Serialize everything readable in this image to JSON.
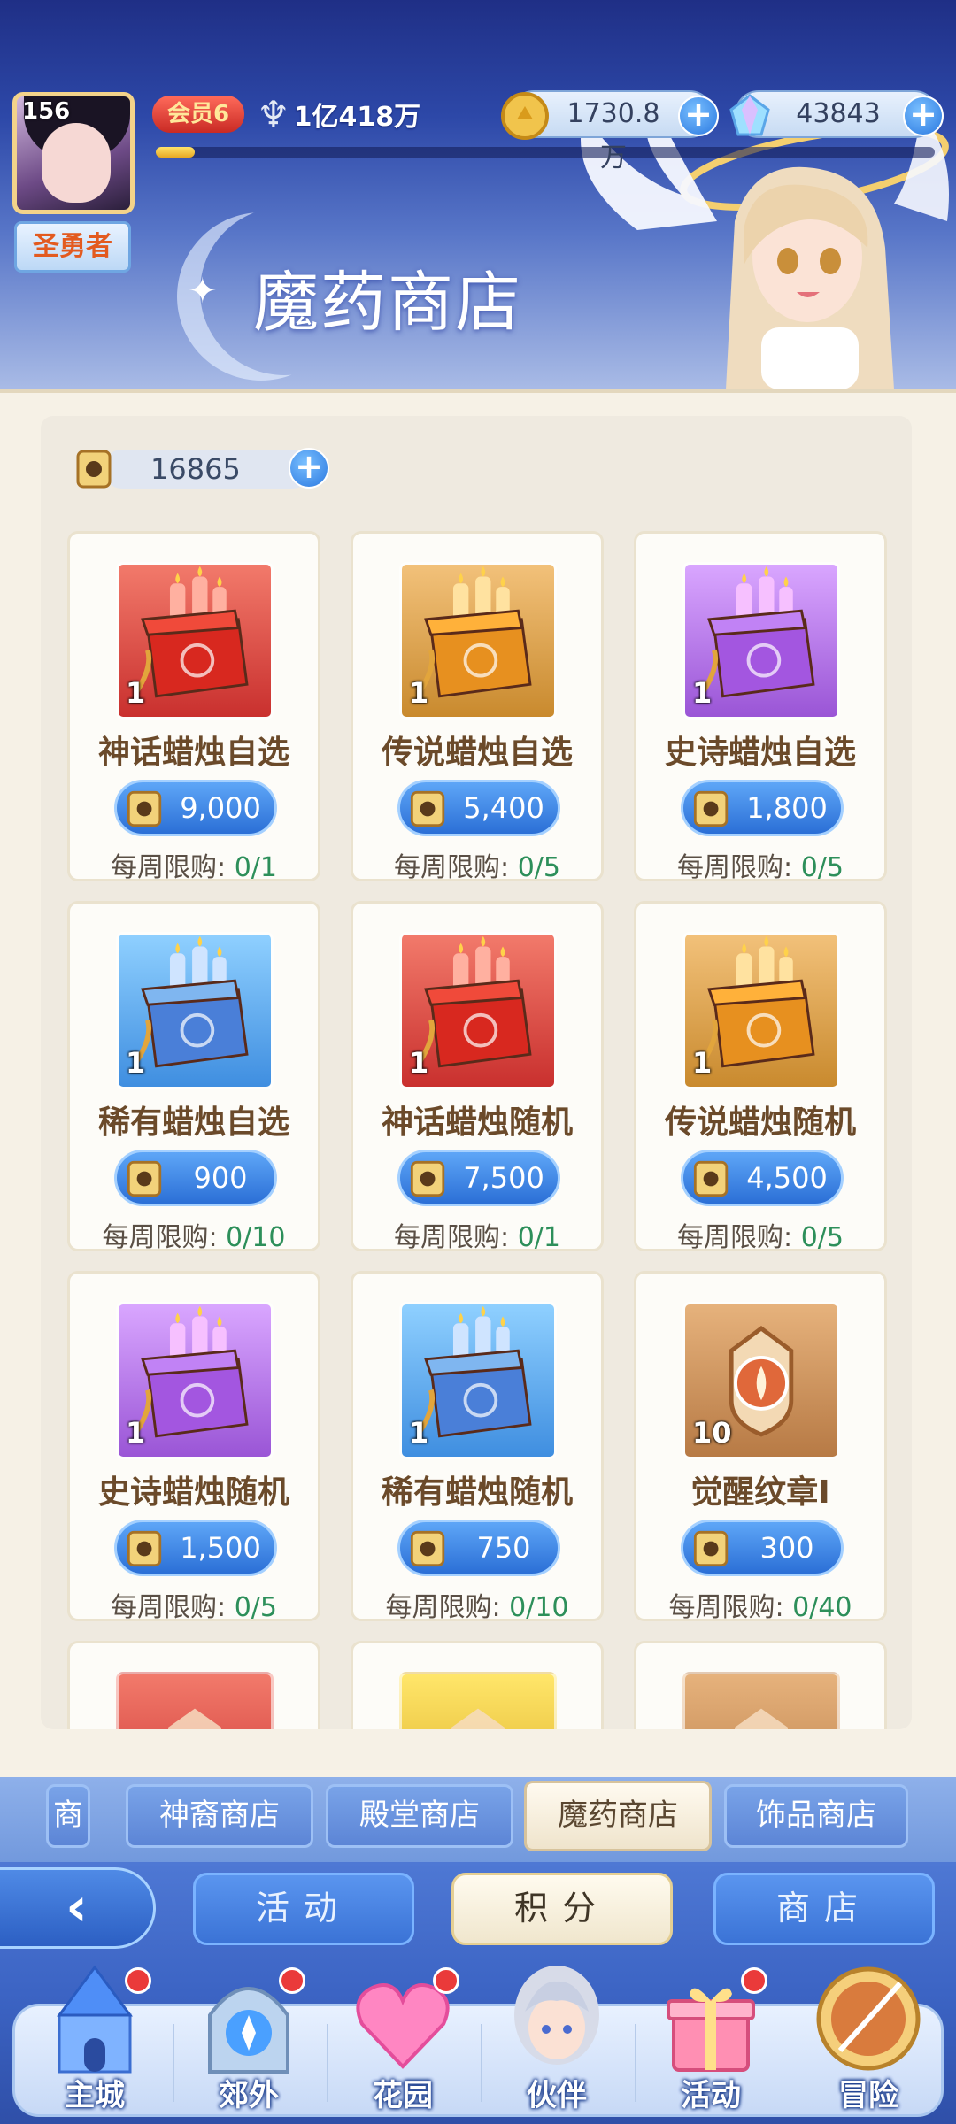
{
  "player": {
    "level": "156",
    "title": "圣勇者",
    "vip": "会员6",
    "power": "1亿418万",
    "exp_fraction": 0.05
  },
  "currencies": {
    "gold": "1730.8万",
    "diamond": "43843",
    "scroll": "16865"
  },
  "shop_title": "魔药商店",
  "items": [
    {
      "name": "神话蜡烛自选",
      "qty": "1",
      "price": "9,000",
      "limit_label": "每周限购:",
      "limit": "0/1",
      "theme": "red"
    },
    {
      "name": "传说蜡烛自选",
      "qty": "1",
      "price": "5,400",
      "limit_label": "每周限购:",
      "limit": "0/5",
      "theme": "orange"
    },
    {
      "name": "史诗蜡烛自选",
      "qty": "1",
      "price": "1,800",
      "limit_label": "每周限购:",
      "limit": "0/5",
      "theme": "purple"
    },
    {
      "name": "稀有蜡烛自选",
      "qty": "1",
      "price": "900",
      "limit_label": "每周限购:",
      "limit": "0/10",
      "theme": "blue"
    },
    {
      "name": "神话蜡烛随机",
      "qty": "1",
      "price": "7,500",
      "limit_label": "每周限购:",
      "limit": "0/1",
      "theme": "red"
    },
    {
      "name": "传说蜡烛随机",
      "qty": "1",
      "price": "4,500",
      "limit_label": "每周限购:",
      "limit": "0/5",
      "theme": "orange"
    },
    {
      "name": "史诗蜡烛随机",
      "qty": "1",
      "price": "1,500",
      "limit_label": "每周限购:",
      "limit": "0/5",
      "theme": "purple"
    },
    {
      "name": "稀有蜡烛随机",
      "qty": "1",
      "price": "750",
      "limit_label": "每周限购:",
      "limit": "0/10",
      "theme": "blue"
    },
    {
      "name": "觉醒纹章I",
      "qty": "10",
      "price": "300",
      "limit_label": "每周限购:",
      "limit": "0/40",
      "theme": "bronze"
    }
  ],
  "tabs": [
    "商店",
    "神裔商店",
    "殿堂商店",
    "魔药商店",
    "饰品商店"
  ],
  "sub_nav": {
    "back": "‹",
    "activity": "活动",
    "points": "积分",
    "shop": "商店"
  },
  "main_nav": [
    "主城",
    "郊外",
    "花园",
    "伙伴",
    "活动",
    "冒险"
  ],
  "colors": {
    "price_blue": "#2b6fd6",
    "limit_green": "#2d8f5a",
    "name_brown": "#6b4a2a",
    "badge_red": "#ea3a3a"
  }
}
